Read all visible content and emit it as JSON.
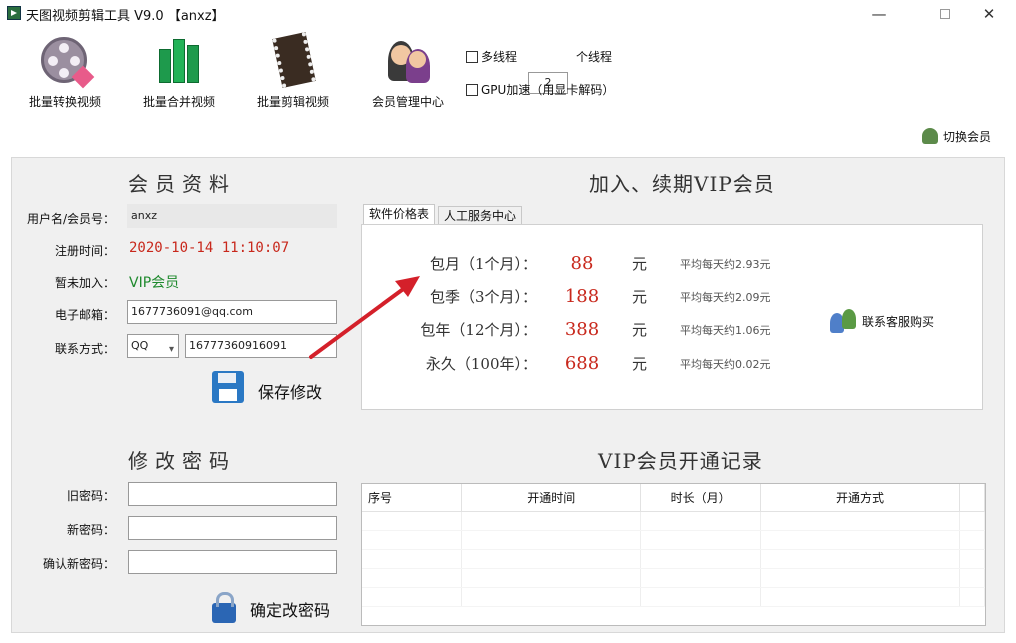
{
  "window": {
    "title": "天图视频剪辑工具 V9.0 【anxz】",
    "minimize": "—",
    "maximize": "",
    "close": "✕"
  },
  "toolbar": {
    "tools": [
      {
        "label": "批量转换视频",
        "icon": "film-reel-heart-icon"
      },
      {
        "label": "批量合并视频",
        "icon": "merge-blocks-icon"
      },
      {
        "label": "批量剪辑视频",
        "icon": "film-strip-scissors-icon"
      },
      {
        "label": "会员管理中心",
        "icon": "members-icon"
      }
    ],
    "multithread_label": "多线程",
    "multithread_checked": false,
    "thread_count": "2",
    "thread_unit": "个线程",
    "gpu_label": "GPU加速（用显卡解码）",
    "gpu_checked": false,
    "switch_member": "切换会员"
  },
  "profile": {
    "title": "会员资料",
    "username_label": "用户名/会员号：",
    "username": "anxz",
    "register_label": "注册时间：",
    "register_time": "2020-10-14 11:10:07",
    "status_label": "暂未加入：",
    "status_value": "VIP会员",
    "email_label": "电子邮箱：",
    "email": "1677736091@qq.com",
    "contact_label": "联系方式：",
    "contact_type": "QQ",
    "contact_value": "16777360916091",
    "save_label": "保存修改"
  },
  "password": {
    "title": "修改密码",
    "old_label": "旧密码：",
    "new_label": "新密码：",
    "confirm_label": "确认新密码：",
    "old_value": "",
    "new_value": "",
    "confirm_value": "",
    "confirm_button": "确定改密码"
  },
  "vip": {
    "title": "加入、续期VIP会员",
    "tabs": [
      {
        "label": "软件价格表",
        "active": true
      },
      {
        "label": "人工服务中心",
        "active": false
      }
    ],
    "plans": [
      {
        "name": "包月（1个月）：",
        "price": "88",
        "unit": "元",
        "avg": "平均每天约2.93元"
      },
      {
        "name": "包季（3个月）：",
        "price": "188",
        "unit": "元",
        "avg": "平均每天约2.09元"
      },
      {
        "name": "包年（12个月）：",
        "price": "388",
        "unit": "元",
        "avg": "平均每天约1.06元"
      },
      {
        "name": "永久（100年）：",
        "price": "688",
        "unit": "元",
        "avg": "平均每天约0.02元"
      }
    ],
    "contact_buy": "联系客服购买"
  },
  "records": {
    "title": "VIP会员开通记录",
    "columns": [
      "序号",
      "开通时间",
      "时长（月）",
      "开通方式"
    ],
    "rows": []
  },
  "colors": {
    "price_red": "#c8281c",
    "status_green": "#1f8a2e",
    "panel_bg": "#f0f0f0",
    "arrow_red": "#d4202a"
  }
}
